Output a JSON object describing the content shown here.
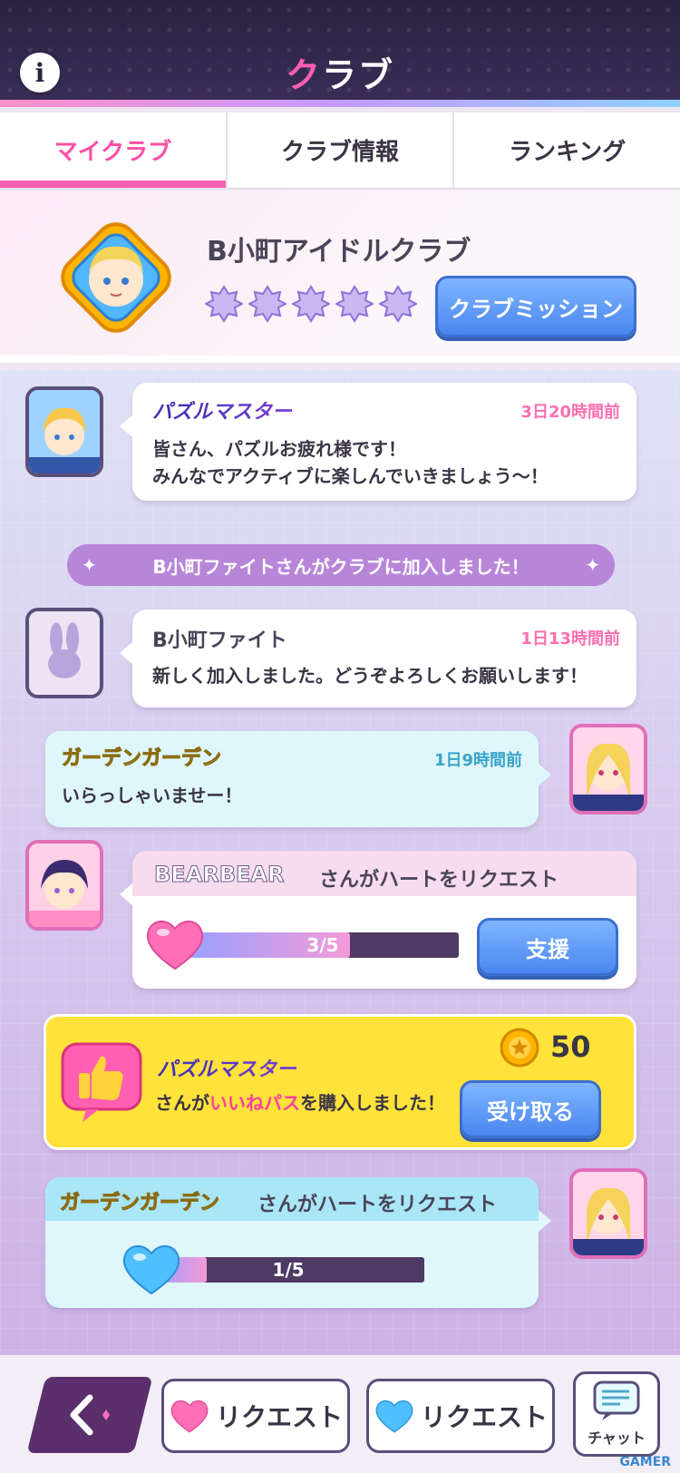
{
  "header": {
    "title_accent": "ク",
    "title_rest": "ラブ",
    "info_glyph": "i"
  },
  "tabs": [
    {
      "label": "マイクラブ",
      "active": true
    },
    {
      "label": "クラブ情報",
      "active": false
    },
    {
      "label": "ランキング",
      "active": false
    }
  ],
  "club": {
    "name": "B小町アイドルクラブ",
    "star_count": 5,
    "mission_button": "クラブミッション"
  },
  "feed": {
    "post1": {
      "author": "パズルマスター",
      "time": "3日20時間前",
      "lines": [
        "皆さん、パズルお疲れ様です！",
        "みんなでアクティブに楽しんでいきましょう〜！"
      ]
    },
    "system": "B小町ファイトさんがクラブに加入しました！",
    "post2": {
      "author": "B小町ファイト",
      "time": "1日13時間前",
      "message": "新しく加入しました。どうぞよろしくお願いします！"
    },
    "post3": {
      "author": "ガーデンガーデン",
      "time": "1日9時間前",
      "message": "いらっしゃいませー！"
    },
    "request1": {
      "requester": "BEARBEAR",
      "suffix": "さんがハートをリクエスト",
      "progress_text": "3/5",
      "progress": 0.6,
      "button": "支援"
    },
    "purchase": {
      "author": "パズルマスター",
      "text_before": "さんが",
      "highlight": "いいねパス",
      "text_after": "を購入しました！",
      "coins": "50",
      "button": "受け取る"
    },
    "request2": {
      "requester": "ガーデンガーデン",
      "suffix": "さんがハートをリクエスト",
      "progress_text": "1/5",
      "progress": 0.2
    }
  },
  "bottom": {
    "request_pink": "リクエスト",
    "request_blue": "リクエスト",
    "chat": "チャット",
    "watermark": "GAMER"
  },
  "colors": {
    "accent_pink": "#ff5fb0",
    "button_blue": "#4a86f0",
    "header_dark": "#2a2140"
  }
}
